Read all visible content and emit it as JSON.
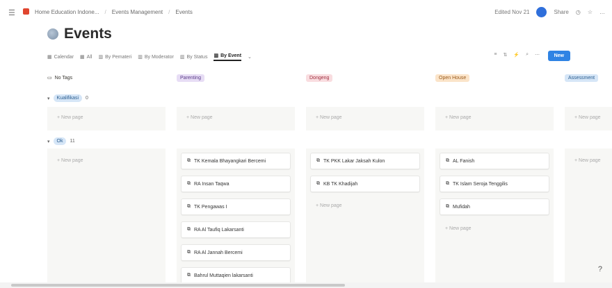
{
  "breadcrumb": [
    "Home Education Indone...",
    "Events Management",
    "Events"
  ],
  "topright": {
    "edited": "Edited Nov 21",
    "share": "Share",
    "more": "…"
  },
  "page": {
    "title": "Events"
  },
  "views": [
    {
      "label": "Calendar"
    },
    {
      "label": "All"
    },
    {
      "label": "By Pemateri"
    },
    {
      "label": "By Moderator"
    },
    {
      "label": "By Status"
    },
    {
      "label": "By Event",
      "active": true
    }
  ],
  "new_button": "New",
  "columns": [
    {
      "label": "No Tags",
      "color": "#ffffff",
      "text": "#37352f"
    },
    {
      "label": "Parenting",
      "color": "#e7ddf5",
      "text": "#5b3c88"
    },
    {
      "label": "Dongeng",
      "color": "#f9dde0",
      "text": "#a03040"
    },
    {
      "label": "Open House",
      "color": "#fbe4c9",
      "text": "#9a5a1c"
    },
    {
      "label": "Assessment",
      "color": "#d6e6f7",
      "text": "#2a5d8f"
    }
  ],
  "groups": [
    {
      "label": "Kualifikasi",
      "count": "0"
    },
    {
      "label": "Ok",
      "count": "11"
    }
  ],
  "new_page_label": "+ New page",
  "cards": {
    "parenting": [
      "TK Kemala Bhayangkari Bercemi",
      "RA Insan Taqwa",
      "TK Pengawas I",
      "RA Al Taufiq Lakarsanti",
      "RA Al Jannah Bercemi",
      "Bahrul Muttaqien lakarsanti"
    ],
    "dongeng": [
      "TK PKK Lakar Jaksah Kulon",
      "KB TK Khadijah"
    ],
    "open_house": [
      "AL Fanish",
      "TK Islam Seroja Tenggilis",
      "Mufidah"
    ]
  }
}
